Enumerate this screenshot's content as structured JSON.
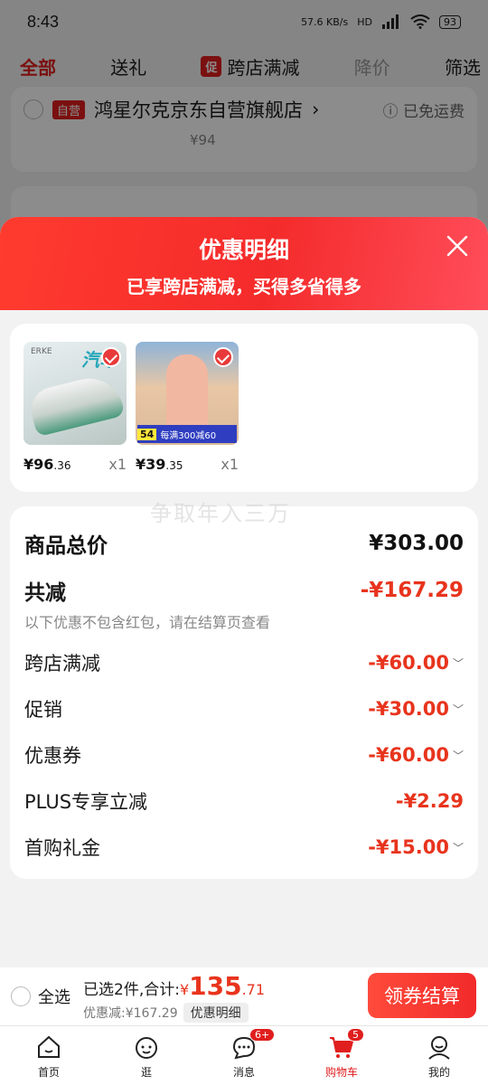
{
  "status_bar": {
    "time": "8:43",
    "net_speed": "57.6 KB/s",
    "hd": "HD",
    "battery": "93"
  },
  "tabs": [
    {
      "label": "全部"
    },
    {
      "label": "送礼"
    },
    {
      "badge": "促",
      "label": "跨店满减"
    },
    {
      "label": "降价"
    },
    {
      "label": "筛选"
    }
  ],
  "store": {
    "badge": "自营",
    "name": "鸿星尔克京东自营旗舰店",
    "chevron": "›",
    "free_shipping": "已免运费",
    "price": "¥94"
  },
  "sheet": {
    "title": "优惠明细",
    "subtitle": "已享跨店满减，买得多省得多",
    "watermark": "争取年入三万"
  },
  "products": [
    {
      "price_int": "¥96",
      "price_dec": ".36",
      "qty": "x1",
      "overlay_text": "汽车"
    },
    {
      "price_int": "¥39",
      "price_dec": ".35",
      "qty": "x1",
      "overlay_price": "54",
      "overlay_promo": "每满300减60"
    }
  ],
  "summary": {
    "total_label": "商品总价",
    "total_value": "¥303.00",
    "reduce_label": "共减",
    "reduce_value": "-¥167.29",
    "note": "以下优惠不包含红包，请在结算页查看",
    "items": [
      {
        "label": "跨店满减",
        "value": "-¥60.00"
      },
      {
        "label": "促销",
        "value": "-¥30.00"
      },
      {
        "label": "优惠券",
        "value": "-¥60.00"
      },
      {
        "label": "PLUS专享立减",
        "value": "-¥2.29"
      },
      {
        "label": "首购礼金",
        "value": "-¥15.00"
      }
    ]
  },
  "bottom_bar": {
    "select_all": "全选",
    "selected_text": "已选2件,合计:",
    "currency": "¥",
    "amount_int": "135",
    "amount_dec": ".71",
    "discount_text": "优惠减:¥167.29",
    "detail_link": "优惠明细",
    "checkout": "领券结算"
  },
  "nav": [
    {
      "label": "首页"
    },
    {
      "label": "逛"
    },
    {
      "label": "消息",
      "badge": "6+"
    },
    {
      "label": "购物车",
      "badge": "5"
    },
    {
      "label": "我的"
    }
  ]
}
